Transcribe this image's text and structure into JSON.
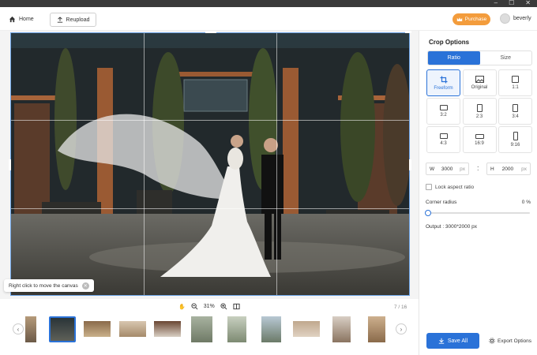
{
  "window": {
    "controls": [
      "–",
      "☐",
      "✕"
    ]
  },
  "topbar": {
    "home_label": "Home",
    "reupload_label": "Reupload",
    "purchase_label": "Purchase",
    "username": "beverly"
  },
  "canvas": {
    "hint_text": "Right click to move the canvas",
    "zoom_level": "31%",
    "page_counter": "7 / 16"
  },
  "panel": {
    "title": "Crop Options",
    "tabs": [
      "Ratio",
      "Size"
    ],
    "active_tab": "Ratio",
    "ratios": [
      {
        "label": "Freeform",
        "icon": "crop-icon",
        "active": true
      },
      {
        "label": "Original",
        "icon": "image-icon",
        "active": false
      },
      {
        "label": "1:1",
        "icon": "square-icon",
        "active": false
      },
      {
        "label": "3:2",
        "icon": "landscape-icon",
        "active": false
      },
      {
        "label": "2:3",
        "icon": "portrait-icon",
        "active": false
      },
      {
        "label": "3:4",
        "icon": "portrait-icon",
        "active": false
      },
      {
        "label": "4:3",
        "icon": "landscape-icon",
        "active": false
      },
      {
        "label": "16:9",
        "icon": "wide-icon",
        "active": false
      },
      {
        "label": "9:16",
        "icon": "tall-icon",
        "active": false
      }
    ],
    "width": {
      "prefix": "W",
      "value": "3000",
      "unit": "px"
    },
    "height": {
      "prefix": "H",
      "value": "2000",
      "unit": "px"
    },
    "lock_label": "Lock aspect ratio",
    "corner_label": "Corner radius",
    "corner_value": "0 %",
    "corner_level": 0,
    "output_text": "Output :  3000*2000 px",
    "save_all_label": "Save All",
    "export_label": "Export Options"
  },
  "colors": {
    "accent": "#2a72d8",
    "purchase": "#f39c3c"
  }
}
